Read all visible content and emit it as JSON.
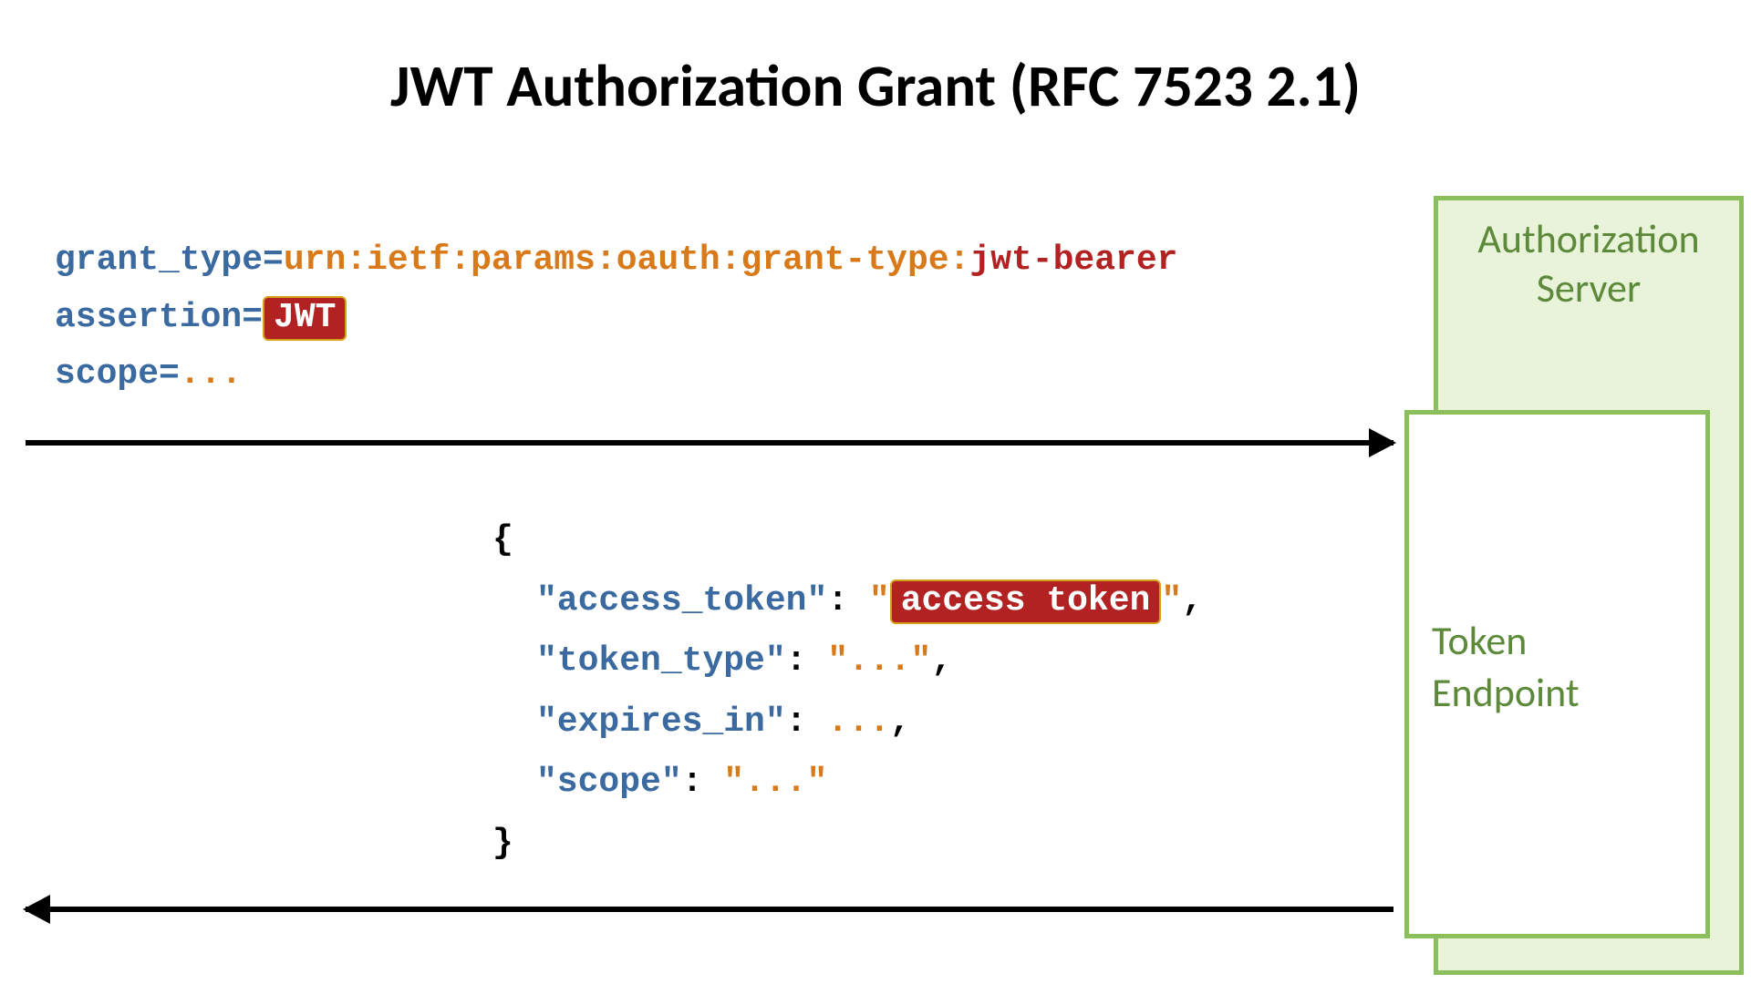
{
  "title": "JWT Authorization Grant (RFC 7523 2.1)",
  "request": {
    "grant_type_label": "grant_type",
    "grant_type_urn": "urn:ietf:params:oauth:grant-type:",
    "grant_type_suffix": "jwt-bearer",
    "assertion_label": "assertion",
    "jwt_badge": "JWT",
    "scope_label": "scope",
    "scope_value": "..."
  },
  "response": {
    "brace_open": "{",
    "brace_close": "}",
    "access_token_key": "\"access_token\"",
    "access_token_badge": "access token",
    "token_type_key": "\"token_type\"",
    "token_type_val": "\"...\"",
    "expires_in_key": "\"expires_in\"",
    "expires_in_val": "...",
    "scope_key": "\"scope\"",
    "scope_val": "\"...\"",
    "q": "\"",
    "colon": ":",
    "comma": ",",
    "eq": "="
  },
  "boxes": {
    "authz_line1": "Authorization",
    "authz_line2": "Server",
    "token_line1": "Token",
    "token_line2": "Endpoint"
  }
}
